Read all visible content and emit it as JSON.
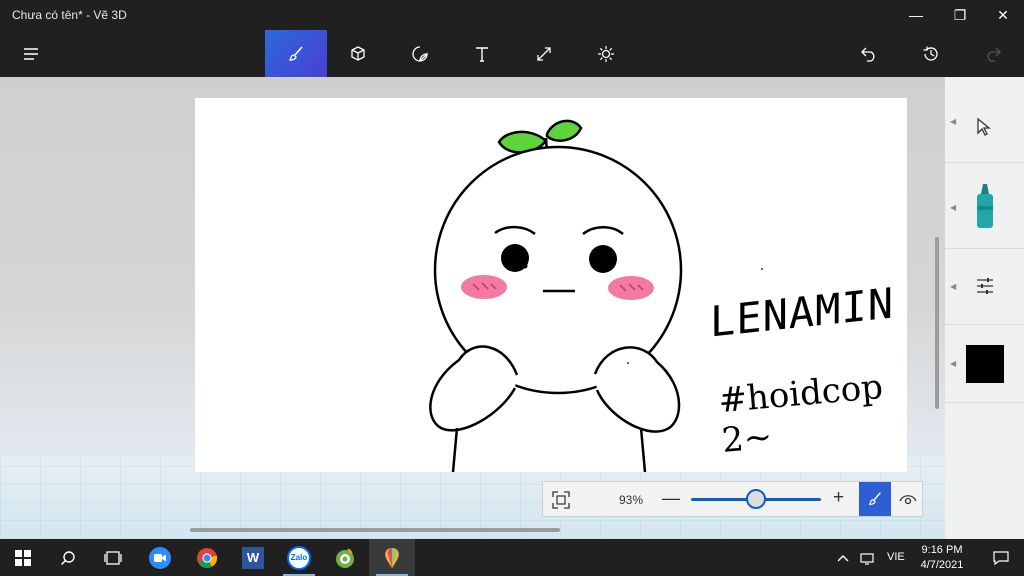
{
  "window": {
    "title": "Chưa có tên* - Vẽ 3D",
    "minimize_glyph": "—",
    "maximize_glyph": "❐",
    "close_glyph": "✕"
  },
  "toolbar": {
    "items": [
      "menu-icon",
      "brushes-icon",
      "3d-shapes-icon",
      "stickers-icon",
      "text-icon",
      "canvas-icon",
      "effects-icon",
      "undo-icon",
      "history-icon",
      "redo-icon"
    ],
    "accent": "#2d5fd3"
  },
  "canvas": {
    "drawing_text_1": "LENAMIN",
    "drawing_text_2": "#hoidcop 2~"
  },
  "zoom": {
    "percent_label": "93%",
    "minus_label": "—",
    "plus_label": "+",
    "level_fraction": 0.5
  },
  "right_panel": {
    "items": [
      "select-cursor-icon",
      "marker-icon",
      "settings-sliders-icon",
      "color-swatch"
    ],
    "current_color": "#000000"
  },
  "taskbar": {
    "apps": [
      "windows-start-icon",
      "search-icon",
      "task-view-icon",
      "zoom-app-icon",
      "chrome-icon",
      "word-icon",
      "zalo-icon",
      "coccoc-icon",
      "paint3d-icon"
    ],
    "zalo_label": "Zalo",
    "word_label": "W",
    "language": "VIE",
    "time": "9:16 PM",
    "date": "4/7/2021"
  }
}
